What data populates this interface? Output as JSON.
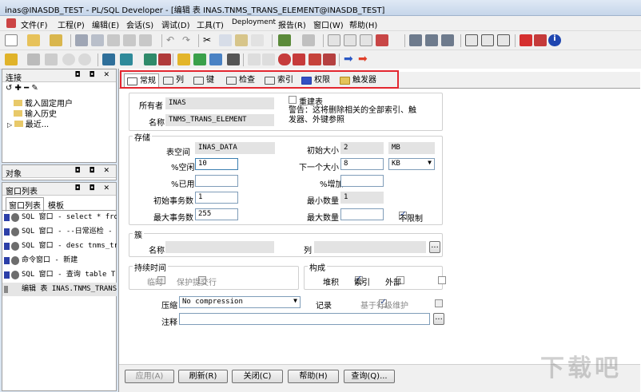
{
  "window": {
    "title": "inas@INASDB_TEST - PL/SQL Developer - [编辑 表 INAS.TNMS_TRANS_ELEMENT@INASDB_TEST]"
  },
  "menu": [
    "文件(F)",
    "工程(P)",
    "编辑(E)",
    "会话(S)",
    "调试(D)",
    "工具(T)",
    "Deployment",
    "报告(R)",
    "窗口(W)",
    "帮助(H)"
  ],
  "connection_panel": {
    "title": "连接",
    "items": [
      "载入固定用户",
      "输入历史",
      "最近..."
    ]
  },
  "objects_panel": {
    "title": "对象"
  },
  "window_list_panel": {
    "title": "窗口列表",
    "tabs": [
      "窗口列表",
      "模板"
    ],
    "items": [
      "SQL 窗口 - select * fro",
      "SQL 窗口 - --日常巡检 -",
      "SQL 窗口 - desc tnms_tr",
      "命令窗口 - 新建",
      "SQL 窗口 - 查询 table T",
      "编辑 表 INAS.TNMS_TRANS"
    ]
  },
  "editor": {
    "tabs": [
      "常规",
      "列",
      "键",
      "检查",
      "索引",
      "权限",
      "触发器"
    ],
    "owner_label": "所有者",
    "owner": "INAS",
    "name_label": "名称",
    "name": "TNMS_TRANS_ELEMENT",
    "recreate_label": "重建表",
    "warning": "警告：这将删除相关的全部索引、触发器、外键参照",
    "storage": {
      "title": "存储",
      "tablespace_label": "表空间",
      "tablespace": "INAS_DATA",
      "pctfree_label": "%空闲",
      "pctfree": "10",
      "pctused_label": "%已用",
      "pctused": "",
      "initrans_label": "初始事务数",
      "initrans": "1",
      "maxtrans_label": "最大事务数",
      "maxtrans": "255",
      "initial_label": "初始大小",
      "initial": "2",
      "initial_unit": "MB",
      "next_label": "下一个大小",
      "next": "8",
      "next_unit": "KB",
      "pctincrease_label": "%增加",
      "pctincrease": "",
      "minextents_label": "最小数量",
      "minextents": "1",
      "maxextents_label": "最大数量",
      "maxextents": "",
      "unlimited_label": "不限制"
    },
    "cluster": {
      "title": "簇",
      "name_label": "名称",
      "name": "",
      "columns_label": "列",
      "columns": "",
      "ellipsis": "..."
    },
    "duration": {
      "title": "持续时间",
      "temporary_label": "临时",
      "preserve_label": "保护提交行"
    },
    "organization": {
      "title": "构成",
      "heap_label": "堆积",
      "index_label": "索引",
      "external_label": "外部"
    },
    "compress_label": "压缩",
    "compress": "No compression",
    "logging_label": "记录",
    "row_movement_label": "基于行级维护",
    "comment_label": "注释",
    "comment": "",
    "comment_ellipsis": "...",
    "buttons": {
      "apply": "应用(A)",
      "refresh": "刷新(R)",
      "close": "关闭(C)",
      "help": "帮助(H)",
      "query": "查询(Q)..."
    }
  },
  "watermark": "下载吧"
}
